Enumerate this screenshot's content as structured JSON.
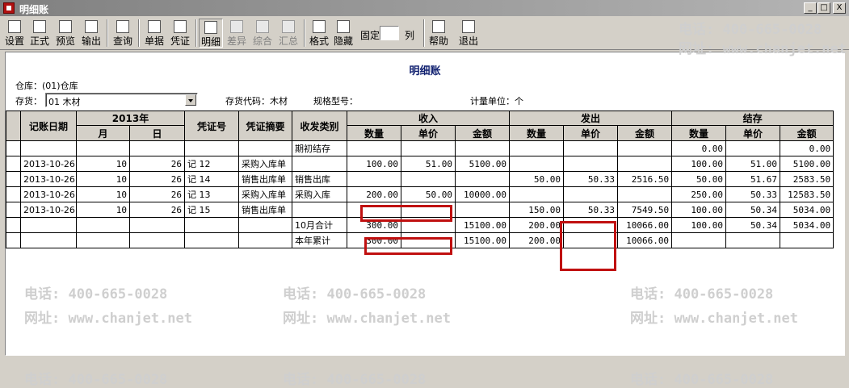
{
  "window": {
    "title": "明细账",
    "min": "_",
    "max": "□",
    "close": "X"
  },
  "toolbar": {
    "buttons": [
      {
        "label": "设置",
        "icon": "settings-icon"
      },
      {
        "label": "正式",
        "icon": "printer-icon"
      },
      {
        "label": "预览",
        "icon": "preview-icon"
      },
      {
        "label": "输出",
        "icon": "export-icon"
      },
      {
        "label": "查询",
        "icon": "binoculars-icon"
      },
      {
        "label": "单据",
        "icon": "document-icon"
      },
      {
        "label": "凭证",
        "icon": "voucher-icon"
      },
      {
        "label": "明细",
        "icon": "detail-icon"
      },
      {
        "label": "差异",
        "icon": "difference-icon"
      },
      {
        "label": "综合",
        "icon": "composite-icon"
      },
      {
        "label": "汇总",
        "icon": "summary-icon"
      },
      {
        "label": "格式",
        "icon": "format-icon"
      },
      {
        "label": "隐藏",
        "icon": "hide-icon"
      },
      {
        "label": "帮助",
        "icon": "help-icon"
      },
      {
        "label": "退出",
        "icon": "exit-icon"
      }
    ],
    "fixed_label": "固定",
    "fixed_value": "",
    "fixed_suffix": "列"
  },
  "report": {
    "title": "明细账",
    "warehouse": "仓库：(01)仓库",
    "inventory_label": "存货：",
    "inventory_value": "01 木材",
    "code": "存货代码：木材",
    "spec": "规格型号：",
    "unit": "计量单位：个"
  },
  "table": {
    "headers": {
      "date": "记账日期",
      "year": "2013年",
      "month": "月",
      "day": "日",
      "voucher": "凭证号",
      "summary": "凭证摘要",
      "category": "收发类别",
      "in": "收入",
      "out": "发出",
      "balance": "结存",
      "qty": "数量",
      "price": "单价",
      "amount": "金额"
    },
    "rows": [
      [
        "",
        "",
        "",
        "",
        "",
        "期初结存",
        "",
        "",
        "",
        "",
        "",
        "",
        "0.00",
        "",
        "0.00"
      ],
      [
        "2013-10-26",
        "10",
        "26",
        "记 12",
        "采购入库单",
        "",
        "100.00",
        "51.00",
        "5100.00",
        "",
        "",
        "",
        "100.00",
        "51.00",
        "5100.00"
      ],
      [
        "2013-10-26",
        "10",
        "26",
        "记 14",
        "销售出库单",
        "销售出库",
        "",
        "",
        "",
        "50.00",
        "50.33",
        "2516.50",
        "50.00",
        "51.67",
        "2583.50"
      ],
      [
        "2013-10-26",
        "10",
        "26",
        "记 13",
        "采购入库单",
        "采购入库",
        "200.00",
        "50.00",
        "10000.00",
        "",
        "",
        "",
        "250.00",
        "50.33",
        "12583.50"
      ],
      [
        "2013-10-26",
        "10",
        "26",
        "记 15",
        "销售出库单",
        "",
        "",
        "",
        "",
        "150.00",
        "50.33",
        "7549.50",
        "100.00",
        "50.34",
        "5034.00"
      ],
      [
        "",
        "",
        "",
        "",
        "",
        "10月合计",
        "300.00",
        "",
        "15100.00",
        "200.00",
        "",
        "10066.00",
        "100.00",
        "50.34",
        "5034.00"
      ],
      [
        "",
        "",
        "",
        "",
        "",
        "本年累计",
        "300.00",
        "",
        "15100.00",
        "200.00",
        "",
        "10066.00",
        "",
        "",
        ""
      ]
    ]
  },
  "watermark": {
    "phone": "电话: 400-665-0028",
    "site": "网址: www.chanjet.net"
  }
}
